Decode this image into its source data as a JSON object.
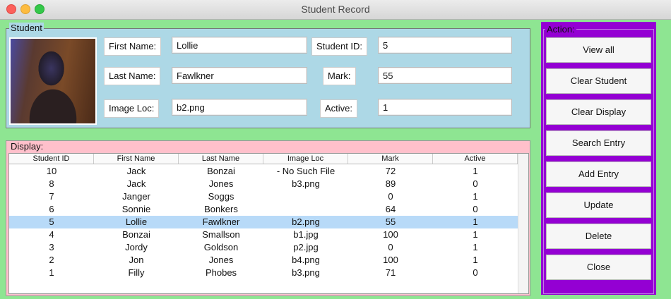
{
  "window": {
    "title": "Student Record"
  },
  "student": {
    "legend": "Student",
    "first_name_label": "First Name:",
    "first_name": "Lollie",
    "last_name_label": "Last Name:",
    "last_name": "Fawlkner",
    "image_loc_label": "Image Loc:",
    "image_loc": "b2.png",
    "student_id_label": "Student ID:",
    "student_id": "5",
    "mark_label": "Mark:",
    "mark": "55",
    "active_label": "Active:",
    "active": "1"
  },
  "display": {
    "legend": "Display:",
    "columns": [
      "Student ID",
      "First Name",
      "Last Name",
      "Image Loc",
      "Mark",
      "Active"
    ],
    "rows": [
      [
        "10",
        "Jack",
        "Bonzai",
        "- No Such File",
        "72",
        "1"
      ],
      [
        "8",
        "Jack",
        "Jones",
        "b3.png",
        "89",
        "0"
      ],
      [
        "7",
        "Janger",
        "Soggs",
        "",
        "0",
        "1"
      ],
      [
        "6",
        "Sonnie",
        "Bonkers",
        "",
        "64",
        "0"
      ],
      [
        "5",
        "Lollie",
        "Fawlkner",
        "b2.png",
        "55",
        "1"
      ],
      [
        "4",
        "Bonzai",
        "Smallson",
        "b1.jpg",
        "100",
        "1"
      ],
      [
        "3",
        "Jordy",
        "Goldson",
        "p2.jpg",
        "0",
        "1"
      ],
      [
        "2",
        "Jon",
        "Jones",
        "b4.png",
        "100",
        "1"
      ],
      [
        "1",
        "Filly",
        "Phobes",
        "b3.png",
        "71",
        "0"
      ]
    ],
    "selected_row": 4
  },
  "action": {
    "legend": "Action:",
    "buttons": [
      "View all",
      "Clear Student",
      "Clear Display",
      "Search Entry",
      "Add Entry",
      "Update",
      "Delete",
      "Close"
    ]
  },
  "colors": {
    "window_bg": "#8ee592",
    "student_bg": "#add8e6",
    "display_bg": "#ffc0cb",
    "action_bg": "#9400d3",
    "selection": "#b8daf8"
  }
}
